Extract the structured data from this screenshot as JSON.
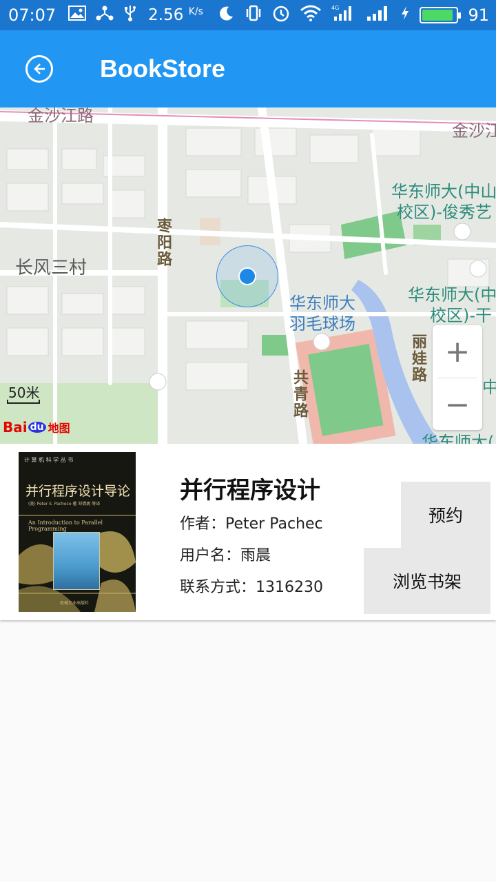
{
  "status_bar": {
    "time": "07:07",
    "net_speed": "2.56",
    "net_speed_unit": "K/s",
    "network_type": "4G",
    "battery_percent": "91",
    "battery_level": 0.91,
    "icons": [
      "image-icon",
      "share-icon",
      "usb-icon",
      "moon-icon",
      "vibrate-icon",
      "alarm-icon",
      "wifi-icon",
      "signal-icon",
      "signal-icon",
      "charging-icon",
      "battery-icon"
    ]
  },
  "app_bar": {
    "title": "BookStore",
    "back_icon": "back-arrow-icon"
  },
  "map": {
    "labels": {
      "road_top_left": "金沙江路",
      "road_top_right": "金沙江",
      "district": "长风三村",
      "road_zaoyang": "枣阳路",
      "road_gongqing": "共青路",
      "road_liwa": "丽娃路",
      "poi_badminton_1": "华东师大",
      "poi_badminton_2": "羽毛球场",
      "poi_campus1_1": "华东师大(中山",
      "poi_campus1_2": "校区)-俊秀艺",
      "poi_campus2_1": "华东师大(中",
      "poi_campus2_2": "校区)-干",
      "poi_campus3": "华东师大(",
      "edge_char": "中"
    },
    "scale_label": "50米",
    "logo": {
      "bai": "Bai",
      "du": "du",
      "ditu": "地图"
    },
    "zoom_in": "+",
    "zoom_out": "−"
  },
  "book": {
    "title": "并行程序设计",
    "author_line": "作者：Peter Pachec",
    "user_line": "用户名：雨晨",
    "contact_line": "联系方式：1316230",
    "cover": {
      "series": "计 算 机 科 学 丛 书",
      "title": "并行程序设计导论",
      "author": "(美) Peter S. Pacheco 著   邓倩妮 等译",
      "subtitle": "An Introduction to Parallel Programming",
      "publisher": "机械工业出版社"
    }
  },
  "buttons": {
    "reserve": "预约",
    "browse_shelf": "浏览书架"
  }
}
